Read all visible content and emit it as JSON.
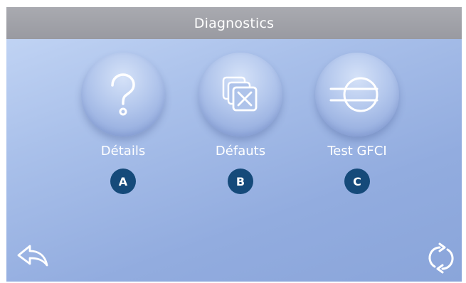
{
  "header": {
    "title": "Diagnostics"
  },
  "menu": [
    {
      "label": "Détails",
      "badge": "A",
      "icon": "question-icon"
    },
    {
      "label": "Défauts",
      "badge": "B",
      "icon": "fault-log-icon"
    },
    {
      "label": "Test GFCI",
      "badge": "C",
      "icon": "gfci-test-icon"
    }
  ],
  "footer": {
    "back_icon": "back-arrow-icon",
    "refresh_icon": "refresh-icon"
  },
  "colors": {
    "title_bar": "#9fa0a6",
    "background": "#a9c0ea",
    "badge": "#154a7a",
    "text": "#ffffff"
  }
}
